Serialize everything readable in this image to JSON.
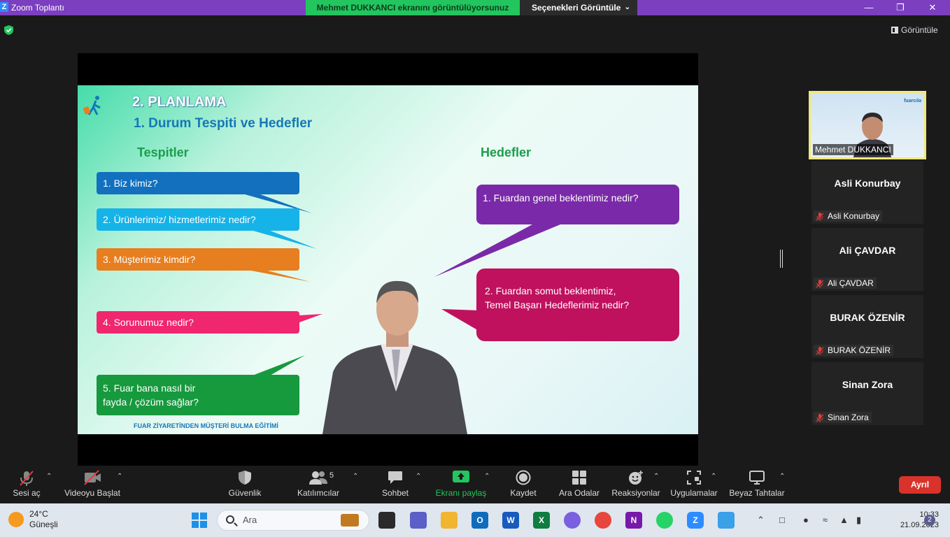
{
  "window": {
    "title": "Zoom Toplantı",
    "share_banner": "Mehmet DUKKANCI ekranını görüntülüyorsunuz",
    "view_options": "Seçenekleri Görüntüle",
    "view_button": "Görüntüle"
  },
  "slide": {
    "heading": "2. PLANLAMA",
    "subheading": "1. Durum Tespiti ve Hedefler",
    "left_title": "Tespitler",
    "right_title": "Hedefler",
    "tespitler": [
      {
        "text": "1. Biz kimiz?",
        "color": "#1270bf"
      },
      {
        "text": "2. Ürünlerimiz/ hizmetlerimiz nedir?",
        "color": "#16b3e8"
      },
      {
        "text": "3. Müşterimiz kimdir?",
        "color": "#e77e1f"
      },
      {
        "text": "4. Sorunumuz nedir?",
        "color": "#f0266e"
      },
      {
        "text": "5. Fuar bana nasıl bir fayda / çözüm sağlar?",
        "color": "#17993e"
      }
    ],
    "hedefler": [
      {
        "text": "1. Fuardan genel beklentimiz nedir?",
        "color": "#7a2aa8"
      },
      {
        "text": "2. Fuardan somut beklentimiz, Temel Başarı Hedeflerimiz nedir?",
        "color": "#c0115e"
      }
    ],
    "footer": "FUAR ZİYARETİNDEN MÜŞTERİ BULMA EĞİTİMİ"
  },
  "participants": {
    "self": {
      "name": "Mehmet DUKKANCI",
      "brand": "fuarcıla"
    },
    "others": [
      {
        "display": "Asli Konurbay",
        "label": "Asli Konurbay"
      },
      {
        "display": "Ali ÇAVDAR",
        "label": "Ali ÇAVDAR"
      },
      {
        "display": "BURAK ÖZENİR",
        "label": "BURAK ÖZENİR"
      },
      {
        "display": "Sinan Zora",
        "label": "Sinan Zora"
      }
    ]
  },
  "toolbar": {
    "unmute": "Sesi aç",
    "start_video": "Videoyu Başlat",
    "security": "Güvenlik",
    "participants": "Katılımcılar",
    "participants_count": "5",
    "chat": "Sohbet",
    "share": "Ekranı paylaş",
    "record": "Kaydet",
    "breakout": "Ara Odalar",
    "reactions": "Reaksiyonlar",
    "apps": "Uygulamalar",
    "whiteboard": "Beyaz Tahtalar",
    "leave": "Ayrıl"
  },
  "taskbar": {
    "temperature": "24°C",
    "weather": "Güneşli",
    "search_placeholder": "Ara",
    "time": "10:33",
    "date": "21.09.2023",
    "notification_count": "2"
  },
  "colors": {
    "titlebar": "#7b3fc0",
    "share_green": "#23c55e",
    "leave_red": "#d9322b"
  }
}
